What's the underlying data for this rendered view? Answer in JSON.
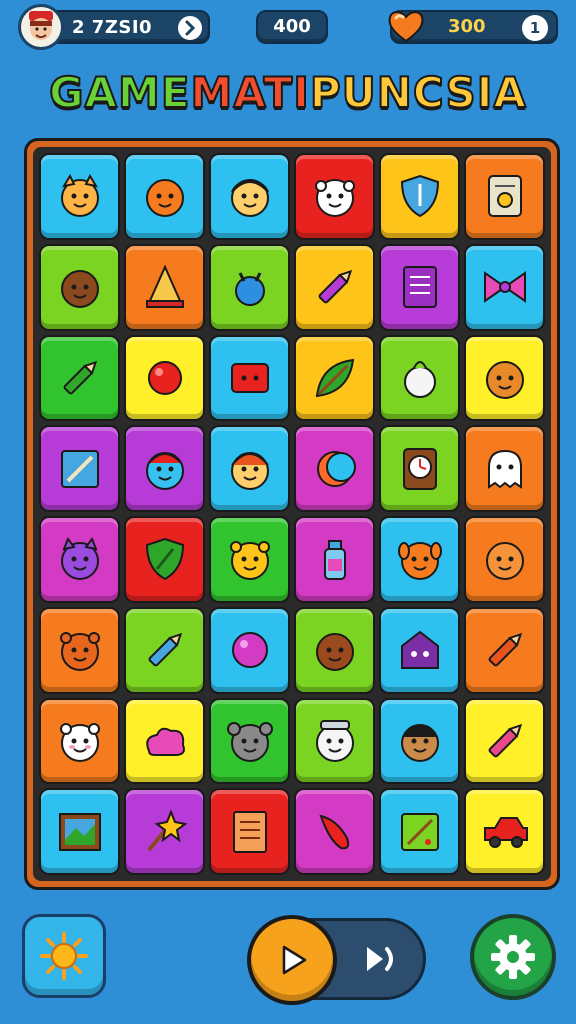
{
  "header": {
    "score": "2 7ZSI0",
    "level": "400",
    "coins": "300",
    "lives_badge": "1",
    "score_arrow_icon": "chevron-right-icon",
    "heart_icon": "heart-icon"
  },
  "title": {
    "parts": [
      "GAME ",
      "MATI ",
      "PUNCSIA"
    ],
    "colors": [
      "#6ad236",
      "#f24d2c",
      "#ffc83a"
    ]
  },
  "board": {
    "rows": [
      [
        {
          "bg": "#2ec0ef",
          "icon": "cat-face-icon"
        },
        {
          "bg": "#2ec0ef",
          "icon": "orange-face-icon"
        },
        {
          "bg": "#2ec0ef",
          "icon": "boy-face-icon"
        },
        {
          "bg": "#e8231f",
          "icon": "white-monster-icon"
        },
        {
          "bg": "#ffc419",
          "icon": "shield-icon"
        },
        {
          "bg": "#f57b1e",
          "icon": "notepad-icon"
        }
      ],
      [
        {
          "bg": "#7bd322",
          "icon": "brown-creature-icon"
        },
        {
          "bg": "#f57b1e",
          "icon": "cone-icon"
        },
        {
          "bg": "#7bd322",
          "icon": "blue-bird-icon"
        },
        {
          "bg": "#ffc419",
          "icon": "pencil-icon"
        },
        {
          "bg": "#b73bd6",
          "icon": "book-icon"
        },
        {
          "bg": "#2ec0ef",
          "icon": "bow-icon"
        }
      ],
      [
        {
          "bg": "#31c42e",
          "icon": "green-pencil-icon"
        },
        {
          "bg": "#fff02a",
          "icon": "red-ball-icon"
        },
        {
          "bg": "#2ec0ef",
          "icon": "red-box-icon"
        },
        {
          "bg": "#ffc419",
          "icon": "leaf-icon"
        },
        {
          "bg": "#7bd322",
          "icon": "onion-icon"
        },
        {
          "bg": "#fff02a",
          "icon": "fuzzy-ball-icon"
        }
      ],
      [
        {
          "bg": "#b73bd6",
          "icon": "frame-icon"
        },
        {
          "bg": "#b73bd6",
          "icon": "blue-monster-icon"
        },
        {
          "bg": "#2ec0ef",
          "icon": "red-hair-face-icon"
        },
        {
          "bg": "#d43bc4",
          "icon": "moon-icon"
        },
        {
          "bg": "#7bd322",
          "icon": "clock-icon"
        },
        {
          "bg": "#f57b1e",
          "icon": "ghost-icon"
        }
      ],
      [
        {
          "bg": "#d43bc4",
          "icon": "purple-cat-icon"
        },
        {
          "bg": "#e8231f",
          "icon": "leaf-shield-icon"
        },
        {
          "bg": "#31c42e",
          "icon": "bear-icon"
        },
        {
          "bg": "#d43bc4",
          "icon": "bottle-icon"
        },
        {
          "bg": "#2ec0ef",
          "icon": "dog-icon"
        },
        {
          "bg": "#f57b1e",
          "icon": "orange-blob-icon"
        }
      ],
      [
        {
          "bg": "#f57b1e",
          "icon": "orange-bear-icon"
        },
        {
          "bg": "#7bd322",
          "icon": "blue-crayon-icon"
        },
        {
          "bg": "#2ec0ef",
          "icon": "magenta-ball-icon"
        },
        {
          "bg": "#7bd322",
          "icon": "brown-bean-icon"
        },
        {
          "bg": "#2ec0ef",
          "icon": "house-icon"
        },
        {
          "bg": "#f57b1e",
          "icon": "rainbow-crayon-icon"
        }
      ],
      [
        {
          "bg": "#f57b1e",
          "icon": "panda-icon"
        },
        {
          "bg": "#fff02a",
          "icon": "pink-cloud-icon"
        },
        {
          "bg": "#31c42e",
          "icon": "mouse-icon"
        },
        {
          "bg": "#7bd322",
          "icon": "jar-ghost-icon"
        },
        {
          "bg": "#2ec0ef",
          "icon": "curly-hair-face-icon"
        },
        {
          "bg": "#fff02a",
          "icon": "pink-crayon-icon"
        }
      ],
      [
        {
          "bg": "#2ec0ef",
          "icon": "painting-icon"
        },
        {
          "bg": "#b73bd6",
          "icon": "star-wand-icon"
        },
        {
          "bg": "#e8231f",
          "icon": "document-icon"
        },
        {
          "bg": "#d43bc4",
          "icon": "red-pepper-icon"
        },
        {
          "bg": "#2ec0ef",
          "icon": "map-icon"
        },
        {
          "bg": "#fff02a",
          "icon": "red-car-icon"
        }
      ]
    ]
  },
  "footer": {
    "sun_icon": "sun-icon",
    "play_icon": "play-icon",
    "skip_icon": "skip-icon",
    "settings_icon": "gear-icon"
  }
}
